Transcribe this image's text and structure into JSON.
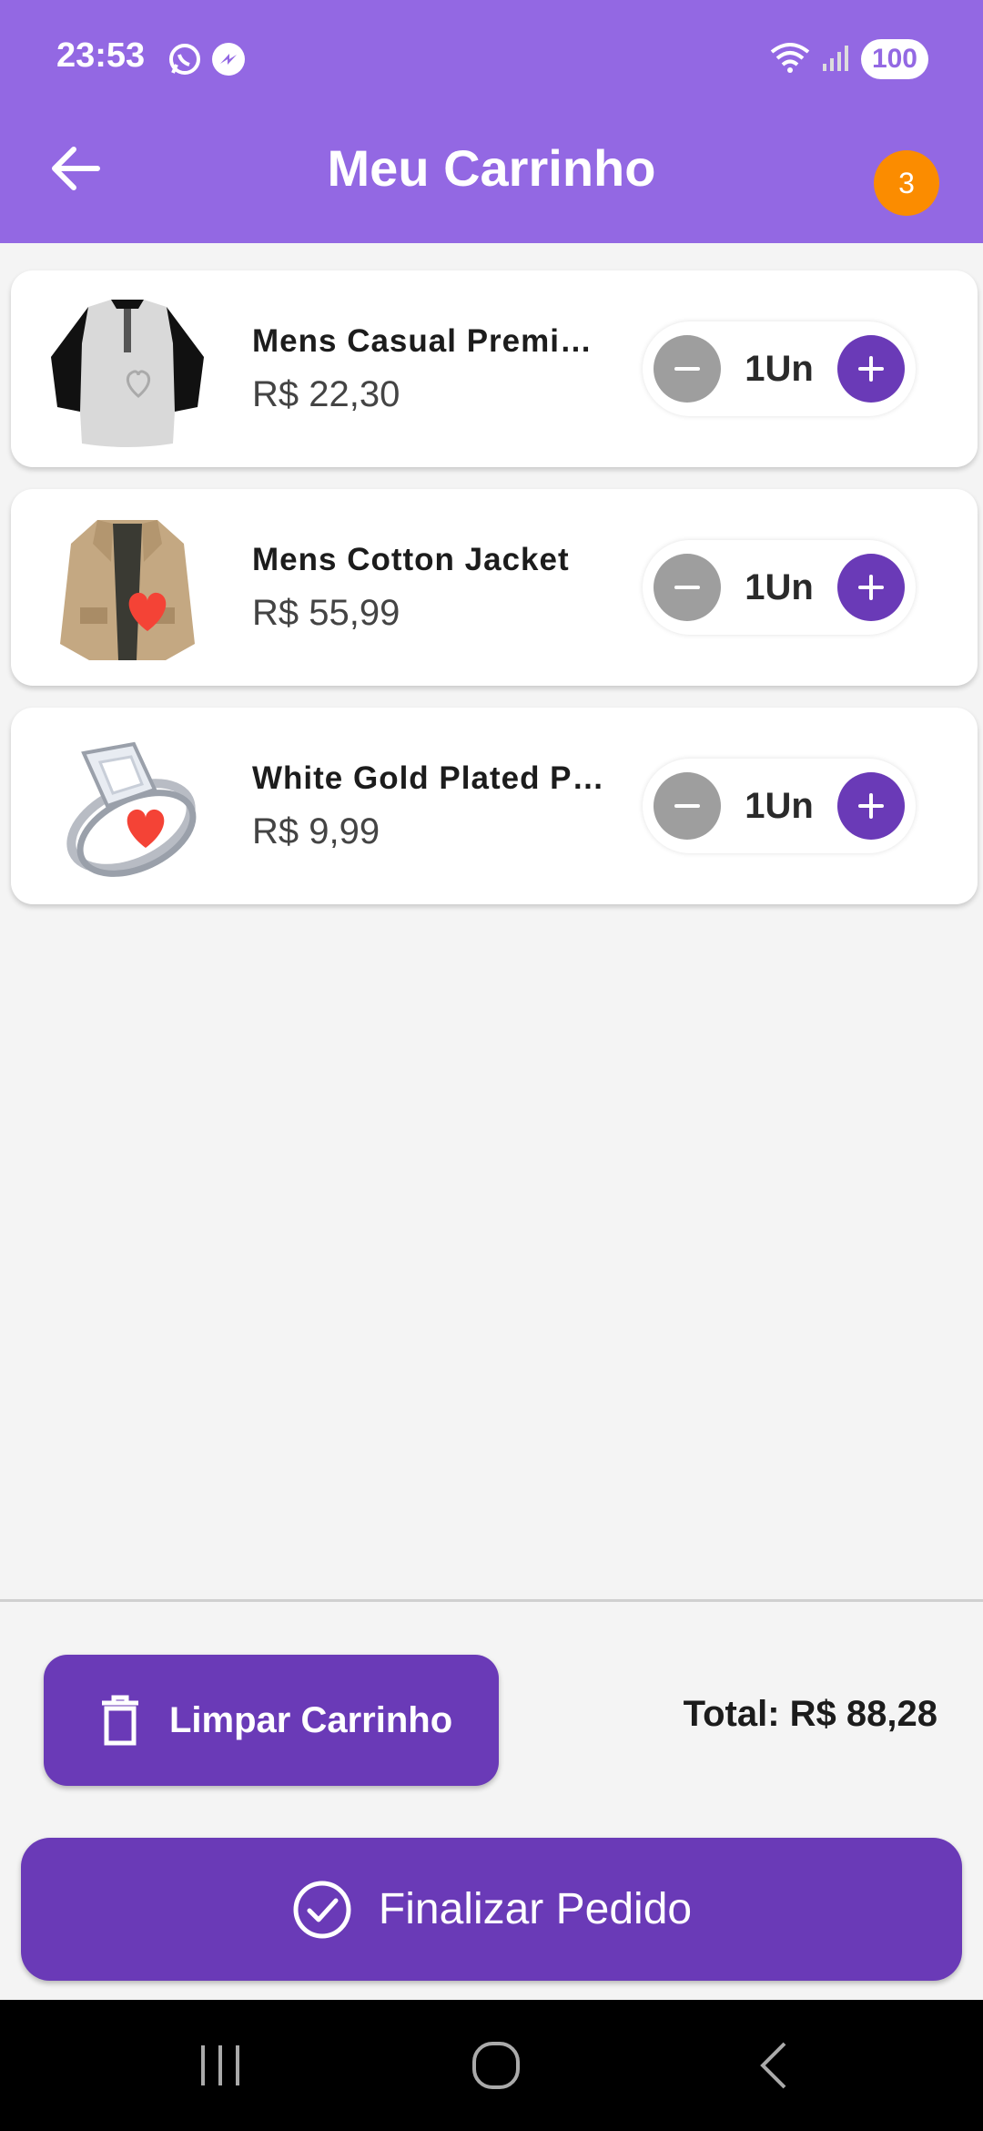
{
  "status_bar": {
    "time": "23:53",
    "battery": "100",
    "icons": [
      "whatsapp-icon",
      "messenger-icon",
      "wifi-icon",
      "signal-icon"
    ]
  },
  "app_bar": {
    "title": "Meu Carrinho",
    "cart_count": "3",
    "colors": {
      "bar": "#9368e3",
      "badge": "#fb8c00"
    }
  },
  "cart": {
    "items": [
      {
        "name": "Mens Casual Premi…",
        "price": "R$ 22,30",
        "quantity": "1Un",
        "favorite": false,
        "image": "shirt-image"
      },
      {
        "name": "Mens Cotton Jacket",
        "price": "R$ 55,99",
        "quantity": "1Un",
        "favorite": true,
        "image": "jacket-image"
      },
      {
        "name": "White Gold Plated P…",
        "price": "R$ 9,99",
        "quantity": "1Un",
        "favorite": true,
        "image": "ring-image"
      }
    ]
  },
  "footer": {
    "clear_label": "Limpar Carrinho",
    "total_label": "Total: R$ 88,28",
    "finish_label": "Finalizar Pedido",
    "colors": {
      "button": "#6a3ab7"
    }
  }
}
